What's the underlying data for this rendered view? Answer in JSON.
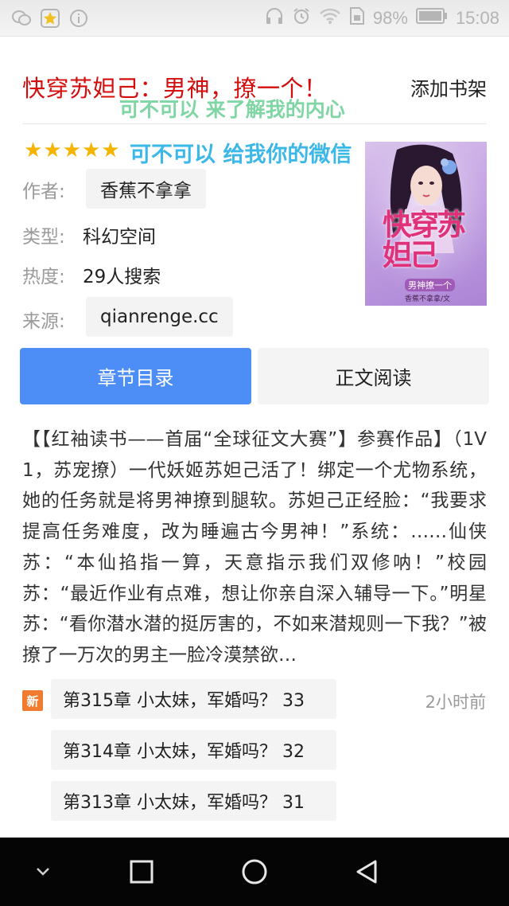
{
  "status_bar": {
    "battery_percent": "98%",
    "time": "15:08",
    "left_icons": [
      "wechat-icon",
      "favorite-icon",
      "info-icon"
    ],
    "right_icons": [
      "headphones-icon",
      "alarm-icon",
      "wifi-icon",
      "sim-icon",
      "signal-icon",
      "battery-icon"
    ]
  },
  "book": {
    "title": "快穿苏妲己：男神，撩一个！",
    "add_to_shelf": "添加书架",
    "overlay_line1": "可不可以 来了解我的内心",
    "overlay_line2": "可不可以 给我你的微信",
    "rating_stars": 5,
    "author_label": "作者:",
    "author": "香蕉不拿拿",
    "genre_label": "类型:",
    "genre": "科幻空间",
    "heat_label": "热度:",
    "heat": "29人搜索",
    "source_label": "来源:",
    "source": "qianrenge.cc",
    "cover": {
      "title_art": "快穿苏妲己",
      "subtitle": "男神撩一个",
      "author_credit": "香蕉不拿拿/文"
    }
  },
  "actions": {
    "toc": "章节目录",
    "read": "正文阅读"
  },
  "description": "【【红袖读书——首届“全球征文大赛”】参赛作品】（1V1，苏宠撩）一代妖姬苏妲己活了！绑定一个尤物系统，她的任务就是将男神撩到腿软。苏妲己正经脸：“我要求提高任务难度，改为睡遍古今男神！”系统：……仙侠苏：“本仙掐指一算，天意指示我们双修呐！”校园苏：“最近作业有点难，想让你亲自深入辅导一下。”明星苏：“看你潜水潜的挺厉害的，不如来潜规则一下我？”被撩了一万次的男主一脸冷漠禁欲…",
  "chapters": {
    "new_badge": "新",
    "updated": "2小时前",
    "items": [
      "第315章 小太妹，军婚吗？ 33",
      "第314章 小太妹，军婚吗？ 32",
      "第313章 小太妹，军婚吗？ 31"
    ]
  },
  "colors": {
    "title": "#d40d0d",
    "primary_button": "#4c8df6",
    "star": "#f5b400",
    "new_badge": "#f07a2e",
    "overlay_green": "#7fd6a4",
    "overlay_blue": "#3bb7e8"
  },
  "nav_bar": [
    "hide-keyboard-icon",
    "recents-icon",
    "home-icon",
    "back-icon"
  ]
}
